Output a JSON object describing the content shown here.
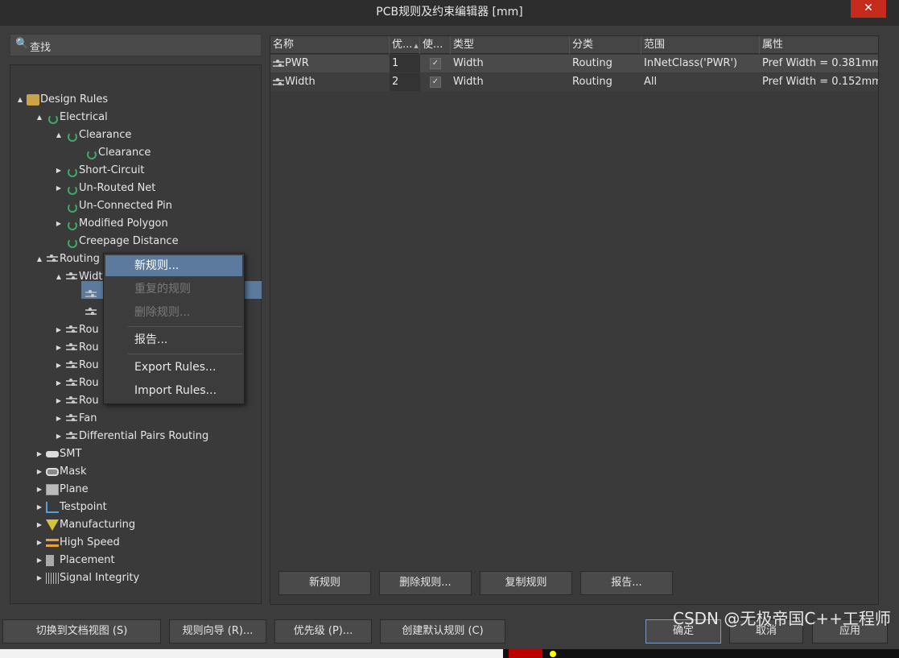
{
  "window": {
    "title": "PCB规则及约束编辑器 [mm]",
    "close_label": "✕"
  },
  "search": {
    "placeholder": "查找",
    "icon": "search-icon"
  },
  "tree": {
    "items": [
      {
        "label": "Design Rules",
        "toggle": "▲",
        "icon": "rules-root-icon"
      },
      {
        "label": "Electrical",
        "toggle": "▲",
        "icon": "electrical-rule-icon"
      },
      {
        "label": "Clearance",
        "toggle": "▲",
        "icon": "electrical-rule-icon"
      },
      {
        "label": "Clearance",
        "toggle": "",
        "icon": "electrical-rule-icon"
      },
      {
        "label": "Short-Circuit",
        "toggle": "▶",
        "icon": "electrical-rule-icon"
      },
      {
        "label": "Un-Routed Net",
        "toggle": "▶",
        "icon": "electrical-rule-icon"
      },
      {
        "label": "Un-Connected Pin",
        "toggle": "",
        "icon": "electrical-rule-icon"
      },
      {
        "label": "Modified Polygon",
        "toggle": "▶",
        "icon": "electrical-rule-icon"
      },
      {
        "label": "Creepage Distance",
        "toggle": "",
        "icon": "electrical-rule-icon"
      },
      {
        "label": "Routing",
        "toggle": "▲",
        "icon": "routing-rule-icon"
      },
      {
        "label": "Width",
        "toggle": "▲",
        "icon": "routing-rule-icon"
      },
      {
        "label": "",
        "toggle": "",
        "icon": "routing-rule-icon"
      },
      {
        "label": "",
        "toggle": "",
        "icon": "routing-rule-icon"
      },
      {
        "label": "Rou",
        "toggle": "▶",
        "icon": "routing-rule-icon"
      },
      {
        "label": "Rou",
        "toggle": "▶",
        "icon": "routing-rule-icon"
      },
      {
        "label": "Rou",
        "toggle": "▶",
        "icon": "routing-rule-icon"
      },
      {
        "label": "Rou",
        "toggle": "▶",
        "icon": "routing-rule-icon"
      },
      {
        "label": "Rou",
        "toggle": "▶",
        "icon": "routing-rule-icon"
      },
      {
        "label": "Fan",
        "toggle": "▶",
        "icon": "routing-rule-icon"
      },
      {
        "label": "Differential Pairs Routing",
        "toggle": "▶",
        "icon": "routing-rule-icon"
      },
      {
        "label": "SMT",
        "toggle": "▶",
        "icon": "smt-icon"
      },
      {
        "label": "Mask",
        "toggle": "▶",
        "icon": "mask-icon"
      },
      {
        "label": "Plane",
        "toggle": "▶",
        "icon": "plane-icon"
      },
      {
        "label": "Testpoint",
        "toggle": "▶",
        "icon": "testpoint-icon"
      },
      {
        "label": "Manufacturing",
        "toggle": "▶",
        "icon": "manufacturing-icon"
      },
      {
        "label": "High Speed",
        "toggle": "▶",
        "icon": "high-speed-icon"
      },
      {
        "label": "Placement",
        "toggle": "▶",
        "icon": "placement-icon"
      },
      {
        "label": "Signal Integrity",
        "toggle": "▶",
        "icon": "signal-integrity-icon"
      }
    ]
  },
  "context_menu": {
    "new_rule": "新规则...",
    "duplicate_rule": "重复的规则",
    "delete_rule": "删除规则...",
    "report": "报告...",
    "export_rules": "Export Rules...",
    "import_rules": "Import Rules..."
  },
  "table": {
    "headers": [
      "名称",
      "优...",
      "使...",
      "类型",
      "分类",
      "范围",
      "属性"
    ],
    "sort_indicator": "▲",
    "rows": [
      {
        "name": "PWR",
        "priority": "1",
        "enabled": "✓",
        "type": "Width",
        "category": "Routing",
        "scope": "InNetClass('PWR')",
        "attributes": "Pref Width = 0.381mm"
      },
      {
        "name": "Width",
        "priority": "2",
        "enabled": "✓",
        "type": "Width",
        "category": "Routing",
        "scope": "All",
        "attributes": "Pref Width = 0.152mm"
      }
    ]
  },
  "grid_buttons": {
    "new_rule": "新规则",
    "delete_rule": "删除规则...",
    "copy_rule": "复制规则",
    "report": "报告..."
  },
  "bottom_buttons": {
    "switch_doc_view": "切换到文档视图 (S)",
    "rule_wizard": "规则向导 (R)...",
    "priorities": "优先级 (P)...",
    "create_default_rules": "创建默认规则 (C)",
    "ok": "确定",
    "cancel": "取消",
    "apply": "应用"
  },
  "watermark": "CSDN @无极帝国C++工程师",
  "colors": {
    "selection": "#5b7a9e",
    "close_button": "#c42b1c",
    "background": "#3c3c3c"
  }
}
